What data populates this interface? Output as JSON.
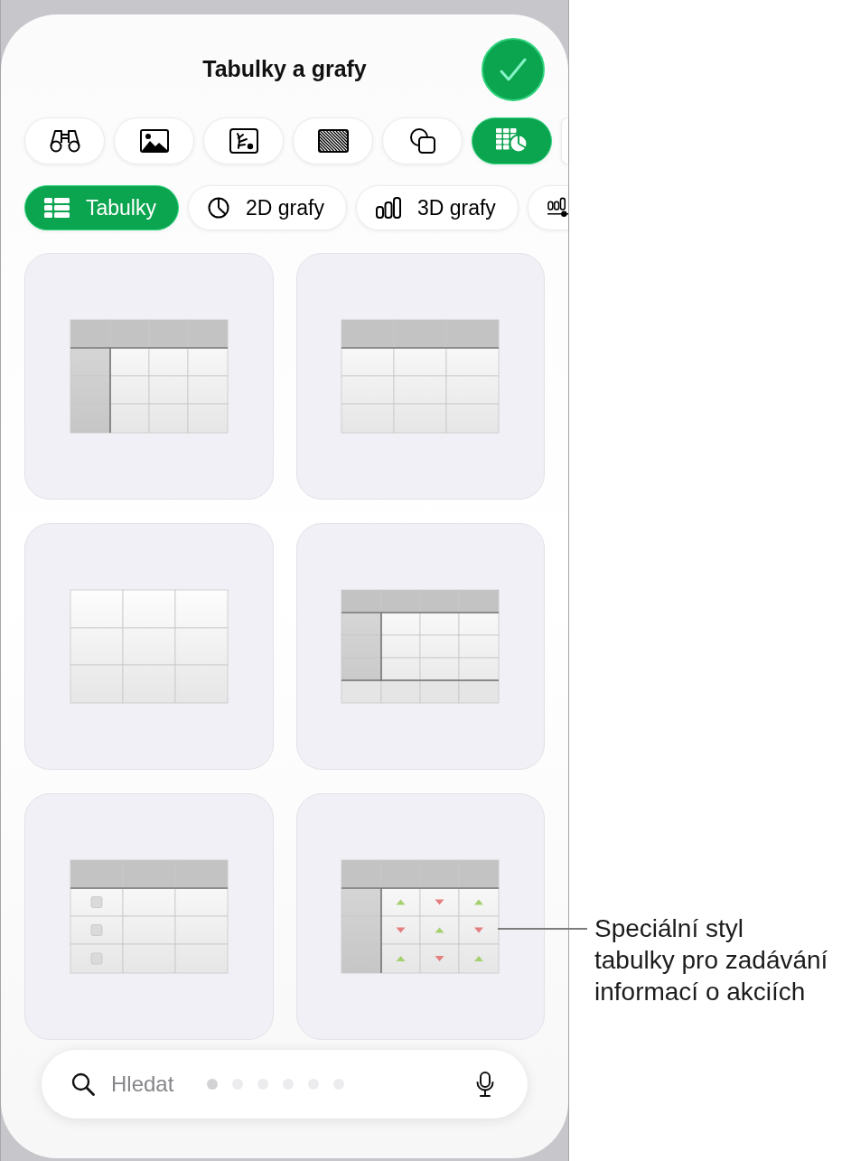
{
  "title": "Tabulky a grafy",
  "insert_tabs": [
    {
      "selected": false
    },
    {
      "selected": false
    },
    {
      "selected": false
    },
    {
      "selected": false
    },
    {
      "selected": false
    },
    {
      "selected": true
    },
    {
      "selected": false
    }
  ],
  "categories": [
    {
      "label": "Tabulky",
      "selected": true
    },
    {
      "label": "2D grafy",
      "selected": false
    },
    {
      "label": "3D grafy",
      "selected": false
    },
    {
      "selected": false
    }
  ],
  "table_styles": [
    {
      "kind": "header-row-column"
    },
    {
      "kind": "header-row"
    },
    {
      "kind": "plain"
    },
    {
      "kind": "header-row-column-footer"
    },
    {
      "kind": "checkbox-column"
    },
    {
      "kind": "stock",
      "rising": [
        [
          true,
          false,
          true
        ],
        [
          false,
          true,
          false
        ],
        [
          true,
          false,
          true
        ]
      ]
    }
  ],
  "search": {
    "placeholder": "Hledat"
  },
  "page_dots": [
    {
      "selected": true
    },
    {
      "selected": false
    },
    {
      "selected": false
    },
    {
      "selected": false
    },
    {
      "selected": false
    },
    {
      "selected": false
    }
  ],
  "callout": {
    "lines": [
      "Speciální styl",
      "tabulky pro zadávání",
      "informací o akciích"
    ]
  }
}
